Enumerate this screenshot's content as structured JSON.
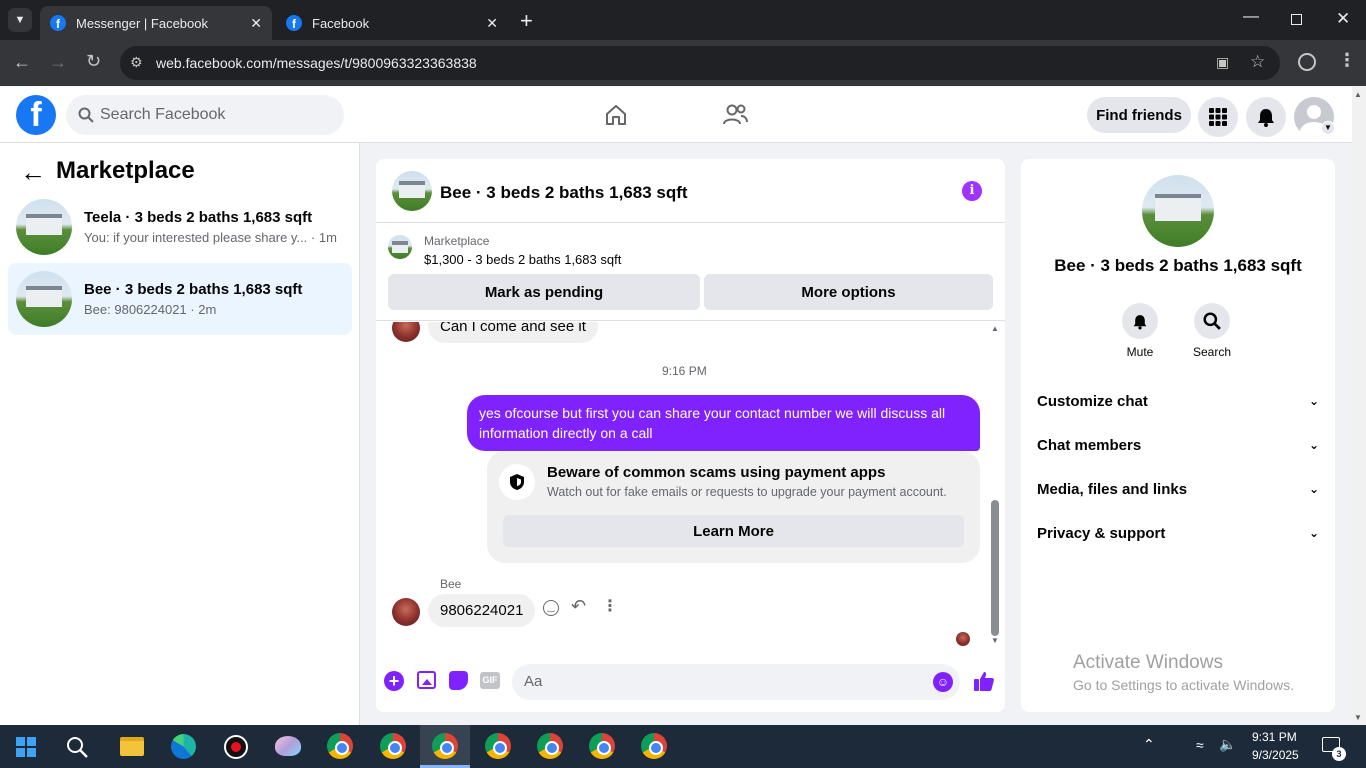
{
  "browser": {
    "tabs": [
      {
        "title": "Messenger | Facebook",
        "active": true
      },
      {
        "title": "Facebook",
        "active": false
      }
    ],
    "url": "web.facebook.com/messages/t/9800963323363838"
  },
  "fb_header": {
    "search_placeholder": "Search Facebook",
    "find_friends": "Find friends"
  },
  "sidebar": {
    "title": "Marketplace",
    "conversations": [
      {
        "title": "Teela · 3 beds 2 baths 1,683 sqft",
        "preview": "You: if your interested please share y...",
        "time": " · 1m"
      },
      {
        "title": "Bee · 3 beds 2 baths 1,683 sqft",
        "preview": "Bee: 9806224021",
        "time": " · 2m",
        "selected": true
      }
    ]
  },
  "chat": {
    "title": "Bee · 3 beds 2 baths 1,683 sqft",
    "listing_label": "Marketplace",
    "listing_detail": "$1,300 - 3 beds 2 baths 1,683 sqft",
    "mark_pending": "Mark as pending",
    "more_options": "More options",
    "msg_incoming_1": "Can I come and see it",
    "timestamp": "9:16 PM",
    "msg_outgoing_1": "yes ofcourse but first you can share your contact number we will discuss all information directly on a call",
    "warning_title": "Beware of common scams using payment apps",
    "warning_body": "Watch out for fake emails or requests to upgrade your payment account.",
    "learn_more": "Learn More",
    "sender_name": "Bee",
    "msg_incoming_2": "9806224021",
    "composer_placeholder": "Aa",
    "accent_color": "#7f22fe"
  },
  "details": {
    "title": "Bee · 3 beds 2 baths 1,683 sqft",
    "mute": "Mute",
    "search": "Search",
    "sections": [
      "Customize chat",
      "Chat members",
      "Media, files and links",
      "Privacy & support"
    ]
  },
  "watermark": {
    "line1": "Activate Windows",
    "line2": "Go to Settings to activate Windows."
  },
  "taskbar": {
    "time": "9:31 PM",
    "date": "9/3/2025",
    "notification_count": "3"
  }
}
